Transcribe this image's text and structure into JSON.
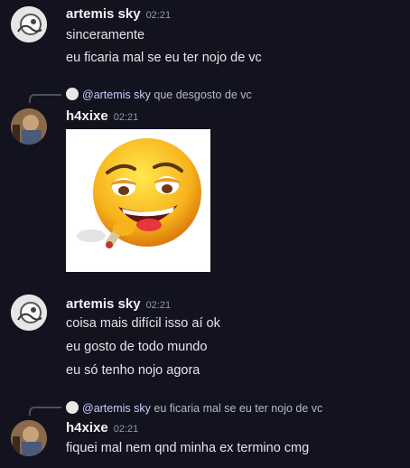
{
  "messages": [
    {
      "author": "artemis sky",
      "time": "02:21",
      "lines": [
        "sinceramente",
        "eu ficaria mal se eu ter nojo de vc"
      ]
    },
    {
      "reply_to": {
        "mention": "@artemis sky",
        "text": "que desgosto de vc"
      },
      "author": "h4xixe",
      "time": "02:21",
      "attachment": "emoji-image"
    },
    {
      "author": "artemis sky",
      "time": "02:21",
      "lines": [
        "coisa mais difícil isso aí ok",
        "eu gosto  de todo mundo",
        "eu só tenho nojo agora"
      ]
    },
    {
      "reply_to": {
        "mention": "@artemis sky",
        "text": "eu ficaria mal se eu ter nojo de vc"
      },
      "author": "h4xixe",
      "time": "02:21",
      "lines": [
        "fiquei mal nem qnd minha ex termino cmg"
      ]
    }
  ],
  "colors": {
    "background": "#13121f",
    "mention": "#c9cdfb"
  }
}
